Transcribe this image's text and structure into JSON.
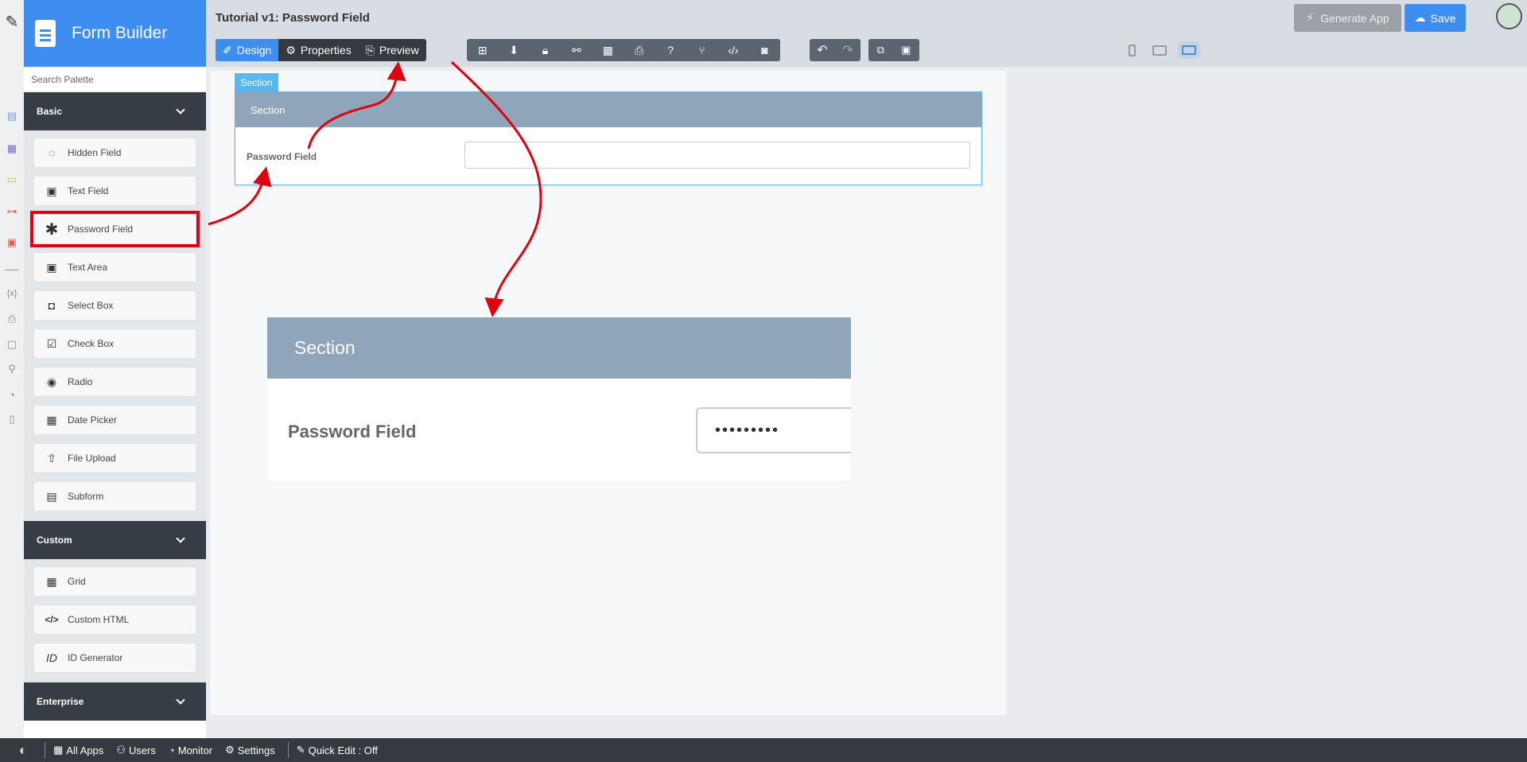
{
  "app": {
    "brand_title": "Form Builder",
    "page_title": "Tutorial v1: Password Field",
    "search_placeholder": "Search Palette"
  },
  "tabs": [
    {
      "label": "Design",
      "icon": "design-icon",
      "active": true
    },
    {
      "label": "Properties",
      "icon": "gear-icon",
      "active": false
    },
    {
      "label": "Preview",
      "icon": "preview-icon",
      "active": false
    }
  ],
  "toolbar": {
    "generate_label": "Generate App",
    "save_label": "Save"
  },
  "palette": {
    "basic": {
      "label": "Basic",
      "items": [
        "Hidden Field",
        "Text Field",
        "Password Field",
        "Text Area",
        "Select Box",
        "Check Box",
        "Radio",
        "Date Picker",
        "File Upload",
        "Subform"
      ]
    },
    "custom": {
      "label": "Custom",
      "items": [
        "Grid",
        "Custom HTML",
        "ID Generator"
      ]
    },
    "enterprise": {
      "label": "Enterprise"
    }
  },
  "form": {
    "section_tag": "Section",
    "section_title": "Section",
    "field_label": "Password Field",
    "field_value": ""
  },
  "zoom_preview": {
    "section_title": "Section",
    "field_label": "Password Field",
    "field_value": "•••••••••"
  },
  "bottom_bar": {
    "all_apps": "All Apps",
    "users": "Users",
    "monitor": "Monitor",
    "settings": "Settings",
    "quick_edit": "Quick Edit : Off"
  },
  "colors": {
    "accent": "#3d8ef0",
    "section_header": "#8ea5ba",
    "annotation_red": "#e0000f",
    "dark_bar": "#343a40"
  }
}
